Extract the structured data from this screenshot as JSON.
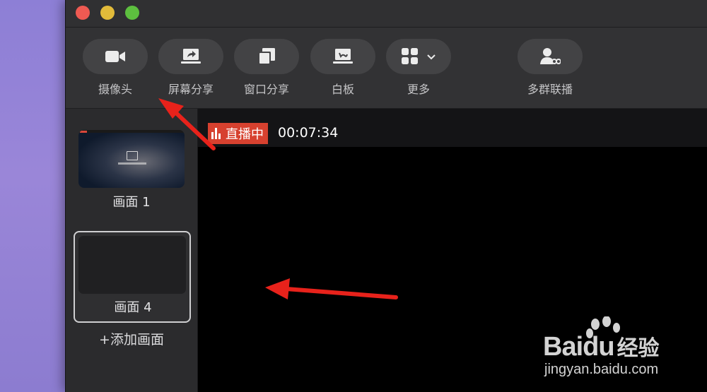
{
  "toolbar": {
    "items": [
      {
        "label": "摄像头",
        "icon": "camera-icon"
      },
      {
        "label": "屏幕分享",
        "icon": "screen-share-icon"
      },
      {
        "label": "窗口分享",
        "icon": "window-share-icon"
      },
      {
        "label": "白板",
        "icon": "whiteboard-icon"
      },
      {
        "label": "更多",
        "icon": "grid-icon"
      },
      {
        "label": "多群联播",
        "icon": "multi-group-icon"
      }
    ]
  },
  "sidebar": {
    "scenes": [
      {
        "label": "画面 1"
      },
      {
        "label": "画面 4",
        "selected": true
      }
    ],
    "add_scene_label": "+添加画面"
  },
  "preview": {
    "live_label": "直播中",
    "timer": "00:07:34"
  },
  "watermark": {
    "brand": "Baidu",
    "brand_cn": "经验",
    "url": "jingyan.baidu.com"
  },
  "colors": {
    "live_badge": "#d7412f",
    "annotation_arrow": "#e8221b"
  }
}
